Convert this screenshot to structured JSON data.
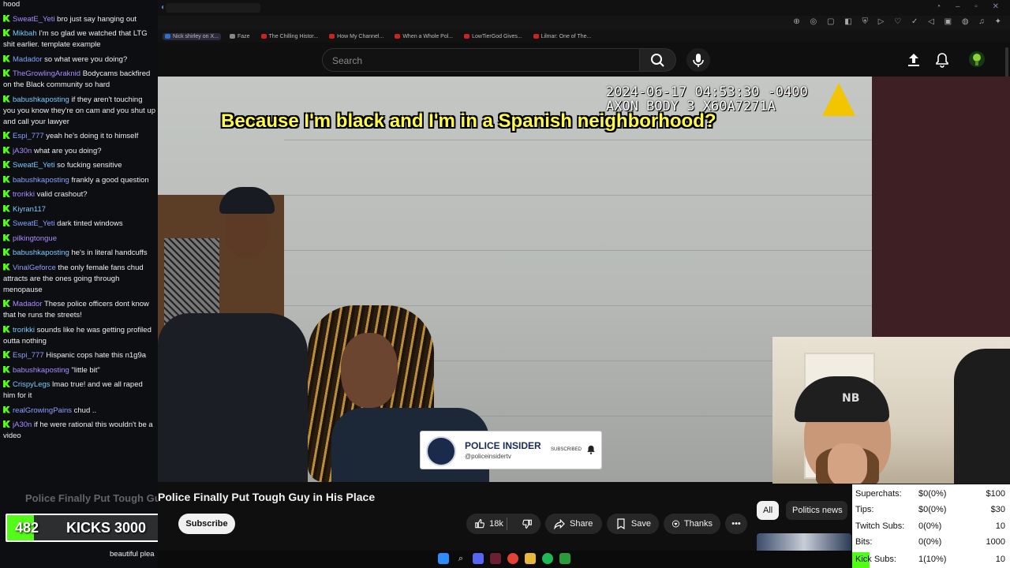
{
  "chat": {
    "messages": [
      {
        "user": "",
        "text": "hood"
      },
      {
        "user": "SweatE_Yeti",
        "text": "bro just say hanging out"
      },
      {
        "user": "Mikbah",
        "text": "I'm so glad we watched that LTG shit earlier. template example"
      },
      {
        "user": "Madador",
        "text": "so what were you doing?"
      },
      {
        "user": "TheGrowlingAraknid",
        "text": "Bodycams backfired on the Black community so hard"
      },
      {
        "user": "babushkaposting",
        "text": "if they aren't touching you you know they're on cam and you shut up and call your lawyer"
      },
      {
        "user": "Espi_777",
        "text": "yeah he's doing it to himself"
      },
      {
        "user": "jA30n",
        "text": "what are you doing?"
      },
      {
        "user": "SweatE_Yeti",
        "text": "so fucking sensitive"
      },
      {
        "user": "babushkaposting",
        "text": "frankly a good question"
      },
      {
        "user": "trorikki",
        "text": "valid crashout?"
      },
      {
        "user": "Kiyran117",
        "text": ""
      },
      {
        "user": "SweatE_Yeti",
        "text": "dark tinted windows"
      },
      {
        "user": "pilkingtongue",
        "text": ""
      },
      {
        "user": "babushkaposting",
        "text": "he's in literal handcuffs"
      },
      {
        "user": "VinalGeforce",
        "text": "the only female fans chud attracts are the ones going through menopause"
      },
      {
        "user": "Madador",
        "text": "These police officers dont know that he runs the streets!"
      },
      {
        "user": "trorikki",
        "text": "sounds like he was getting profiled outta nothing"
      },
      {
        "user": "Espi_777",
        "text": "Hispanic cops hate this n1g9a"
      },
      {
        "user": "babushkaposting",
        "text": "\"little bit\""
      },
      {
        "user": "CrispyLegs",
        "text": "lmao true! and we all raped him for it"
      },
      {
        "user": "realGrowingPains",
        "text": "chud .."
      },
      {
        "user": "jA30n",
        "text": "if he were rational this wouldn't be a video"
      }
    ],
    "ghost_bottom": "beautiful plea"
  },
  "kicks": {
    "count": "482",
    "label": "KICKS 3000",
    "progress": 0.16
  },
  "browser": {
    "bookmarks": [
      {
        "label": "Nick shirley on X...",
        "color": "#2f6fd1"
      },
      {
        "label": "Faze",
        "color": "#888888"
      },
      {
        "label": "The Chilling Histor...",
        "color": "#cc2222"
      },
      {
        "label": "How My Channel...",
        "color": "#cc2222"
      },
      {
        "label": "When a Whole Pol...",
        "color": "#cc2222"
      },
      {
        "label": "LowTierGod Gives...",
        "color": "#cc2222"
      },
      {
        "label": "Lilmar: One of The...",
        "color": "#cc2222"
      }
    ]
  },
  "youtube": {
    "search_placeholder": "Search",
    "video_title": "Police Finally Put Tough Guy in His Place",
    "subscribe_label": "Subscribe",
    "like_count": "18k",
    "share_label": "Share",
    "save_label": "Save",
    "thanks_label": "Thanks",
    "chips": [
      "All",
      "Politics news"
    ]
  },
  "video": {
    "bodycam_timestamp": "2024-06-17 04:53:30 -0400",
    "bodycam_device": "AXON BODY 3 X60A7271A",
    "subtitle": "Because I'm black and I'm in a Spanish neighborhood?",
    "channel_card": {
      "name": "POLICE INSIDER",
      "handle": "@policeinsidertv",
      "status": "SUBSCRIBED"
    }
  },
  "stats": {
    "rows": [
      {
        "label": "Superchats:",
        "mid": "$0(0%)",
        "right": "$100"
      },
      {
        "label": "Tips:",
        "mid": "$0(0%)",
        "right": "$30"
      },
      {
        "label": "Twitch Subs:",
        "mid": "0(0%)",
        "right": "10"
      },
      {
        "label": "Bits:",
        "mid": "0(0%)",
        "right": "1000"
      },
      {
        "label": "Kick Subs:",
        "mid": "1(10%)",
        "right": "10"
      }
    ]
  },
  "colors": {
    "kick_green": "#53fc18",
    "subtitle_yellow": "#fff94c",
    "axon_yellow": "#f2c500"
  }
}
